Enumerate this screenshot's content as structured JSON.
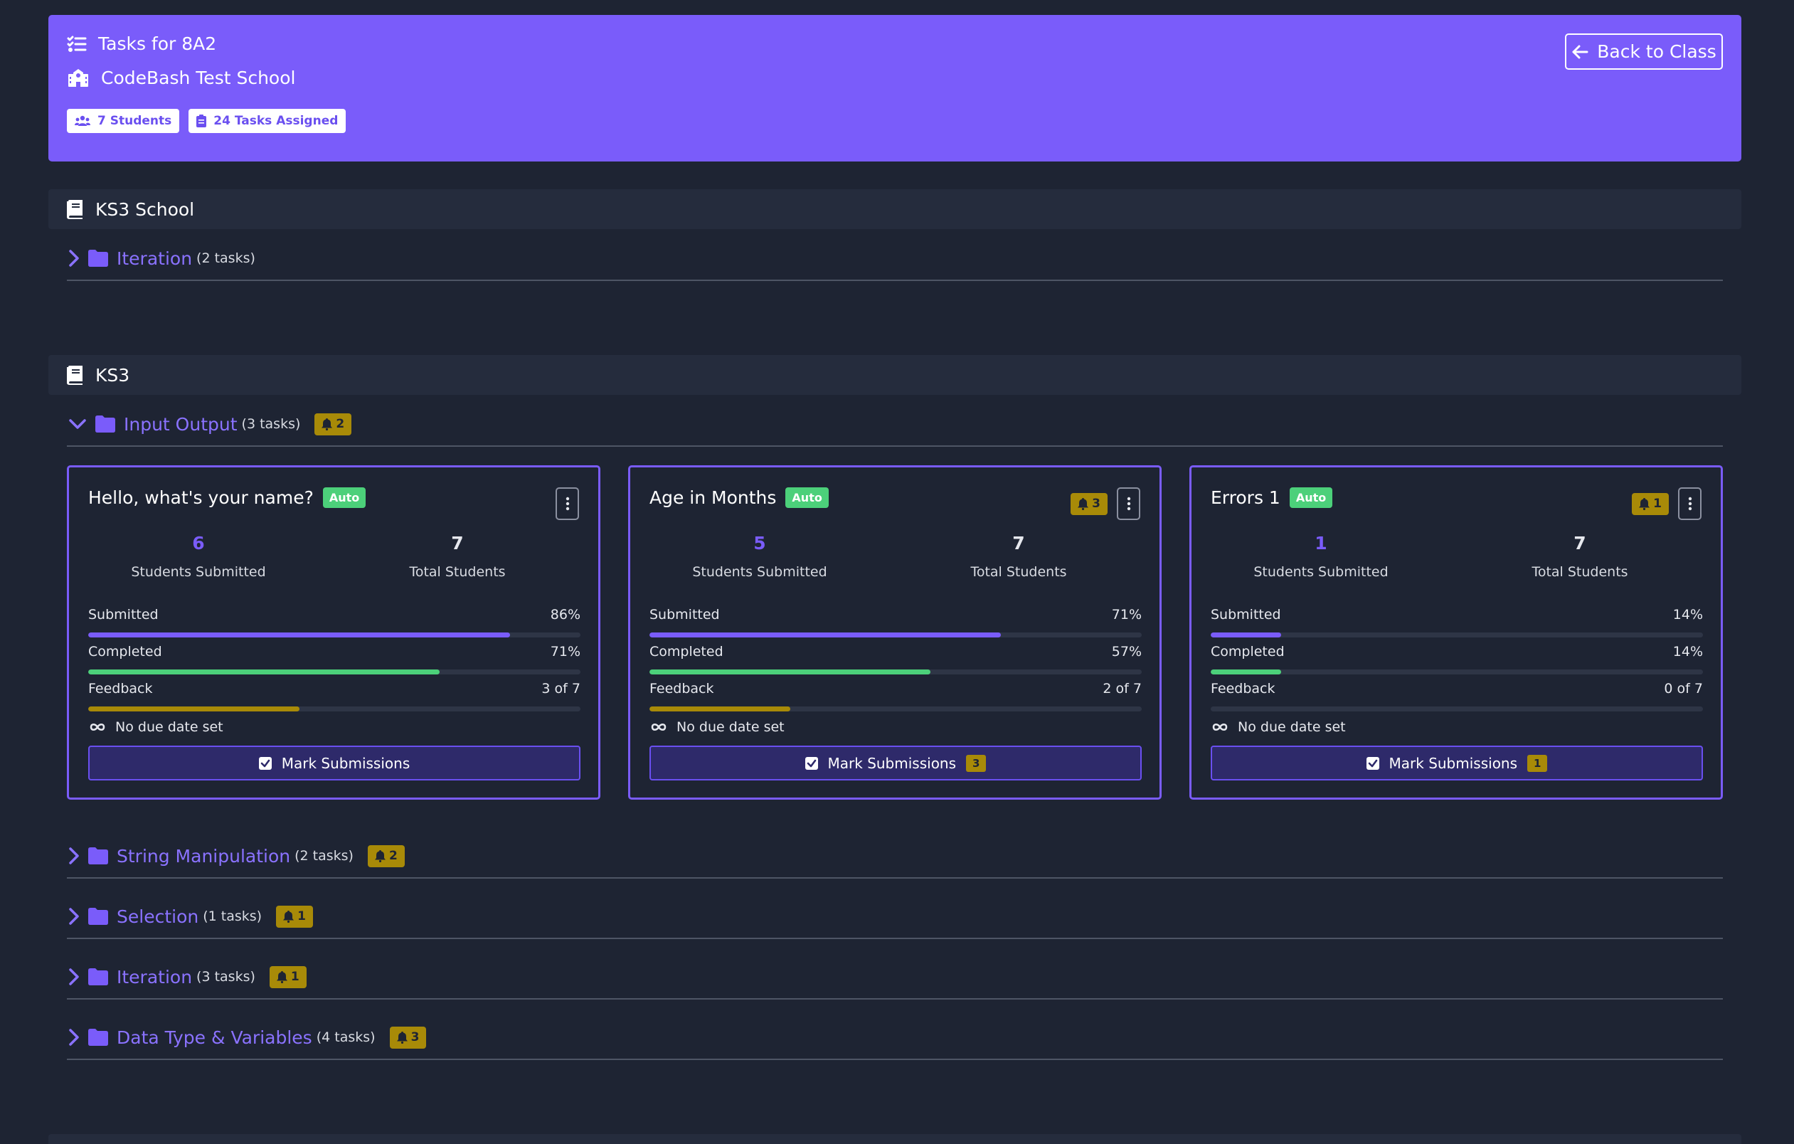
{
  "header": {
    "title": "Tasks for 8A2",
    "school": "CodeBash Test School",
    "back_label": "Back to Class",
    "students_pill": "7 Students",
    "tasks_pill": "24 Tasks Assigned"
  },
  "sections": [
    {
      "title": "KS3 School",
      "folders": [
        {
          "name": "Iteration",
          "count": "(2 tasks)",
          "expanded": false,
          "bell": ""
        }
      ]
    },
    {
      "title": "KS3",
      "folders": [
        {
          "name": "Input Output",
          "count": "(3 tasks)",
          "expanded": true,
          "bell": "2"
        },
        {
          "name": "String Manipulation",
          "count": "(2 tasks)",
          "expanded": false,
          "bell": "2"
        },
        {
          "name": "Selection",
          "count": "(1 tasks)",
          "expanded": false,
          "bell": "1"
        },
        {
          "name": "Iteration",
          "count": "(3 tasks)",
          "expanded": false,
          "bell": "1"
        },
        {
          "name": "Data Type & Variables",
          "count": "(4 tasks)",
          "expanded": false,
          "bell": "3"
        }
      ]
    }
  ],
  "tasks": [
    {
      "title": "Hello, what's your name?",
      "badge": "Auto",
      "bell": "",
      "submitted_count": "6",
      "submitted_label": "Students Submitted",
      "total_count": "7",
      "total_label": "Total Students",
      "submitted_text": "Submitted",
      "submitted_pct": "86%",
      "submitted_frac": 0.857,
      "completed_text": "Completed",
      "completed_pct": "71%",
      "completed_frac": 0.714,
      "feedback_text": "Feedback",
      "feedback_value": "3 of 7",
      "feedback_frac": 0.4286,
      "due": "No due date set",
      "mark_label": "Mark Submissions",
      "mark_count": ""
    },
    {
      "title": "Age in Months",
      "badge": "Auto",
      "bell": "3",
      "submitted_count": "5",
      "submitted_label": "Students Submitted",
      "total_count": "7",
      "total_label": "Total Students",
      "submitted_text": "Submitted",
      "submitted_pct": "71%",
      "submitted_frac": 0.714,
      "completed_text": "Completed",
      "completed_pct": "57%",
      "completed_frac": 0.571,
      "feedback_text": "Feedback",
      "feedback_value": "2 of 7",
      "feedback_frac": 0.2857,
      "due": "No due date set",
      "mark_label": "Mark Submissions",
      "mark_count": "3"
    },
    {
      "title": "Errors 1",
      "badge": "Auto",
      "bell": "1",
      "submitted_count": "1",
      "submitted_label": "Students Submitted",
      "total_count": "7",
      "total_label": "Total Students",
      "submitted_text": "Submitted",
      "submitted_pct": "14%",
      "submitted_frac": 0.143,
      "completed_text": "Completed",
      "completed_pct": "14%",
      "completed_frac": 0.143,
      "feedback_text": "Feedback",
      "feedback_value": "0 of 7",
      "feedback_frac": 0,
      "due": "No due date set",
      "mark_label": "Mark Submissions",
      "mark_count": "1"
    }
  ],
  "colors": {
    "background": "#1e2433",
    "accent": "#7a5cfa",
    "success": "#4cd07a",
    "warning": "#a88a08"
  }
}
